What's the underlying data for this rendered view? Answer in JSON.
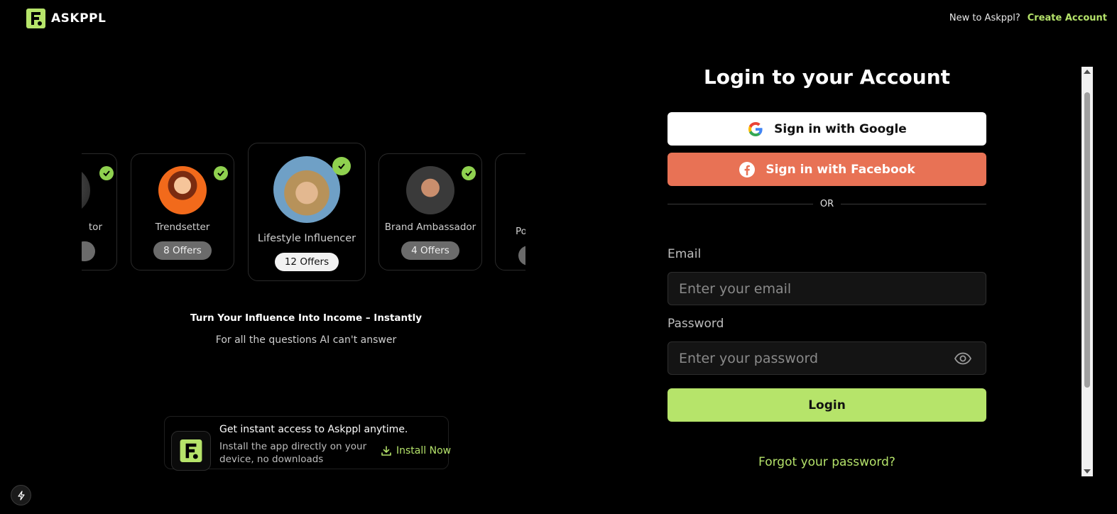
{
  "header": {
    "logo_text": "ASKPPL",
    "new_prompt": "New to Askppl?",
    "create_account": "Create Account"
  },
  "carousel": {
    "cards": [
      {
        "role": "tor",
        "offers": ""
      },
      {
        "role": "Trendsetter",
        "offers": "8 Offers"
      },
      {
        "role": "Lifestyle Influencer",
        "offers": "12 Offers"
      },
      {
        "role": "Brand Ambassador",
        "offers": "4 Offers"
      },
      {
        "role": "Po",
        "offers": ""
      }
    ]
  },
  "promo": {
    "tagline": "Turn Your Influence Into Income – Instantly",
    "subtag": "For all the questions AI can't answer"
  },
  "install": {
    "title": "Get instant access to Askppl anytime.",
    "description": "Install the app directly on your device, no downloads",
    "button": "Install Now"
  },
  "login": {
    "title": "Login to your Account",
    "google": "Sign in with Google",
    "facebook": "Sign in with Facebook",
    "or": "OR",
    "email_label": "Email",
    "email_placeholder": "Enter your email",
    "password_label": "Password",
    "password_placeholder": "Enter your password",
    "login_button": "Login",
    "forgot": "Forgot your password?"
  },
  "colors": {
    "accent": "#b6e46a",
    "facebook": "#e87255",
    "background": "#000000"
  }
}
